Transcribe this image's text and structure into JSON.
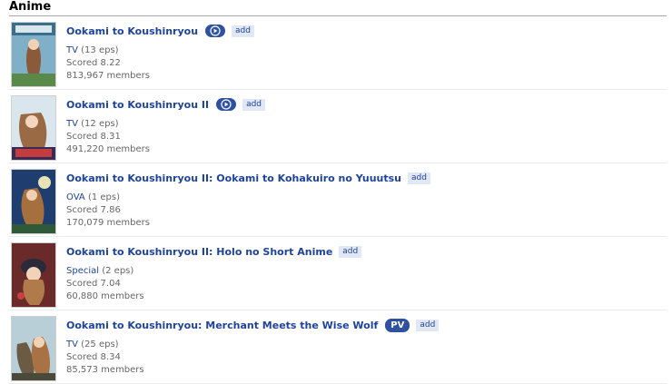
{
  "section": {
    "title": "Anime"
  },
  "entries": [
    {
      "title": "Ookami to Koushinryou",
      "type": "TV",
      "eps": "(13 eps)",
      "score": "Scored 8.22",
      "members": "813,967 members",
      "badge": "play",
      "add": "add"
    },
    {
      "title": "Ookami to Koushinryou II",
      "type": "TV",
      "eps": "(12 eps)",
      "score": "Scored 8.31",
      "members": "491,220 members",
      "badge": "play",
      "add": "add"
    },
    {
      "title": "Ookami to Koushinryou II: Ookami to Kohakuiro no Yuuutsu",
      "type": "OVA",
      "eps": "(1 eps)",
      "score": "Scored 7.86",
      "members": "170,079 members",
      "badge": "none",
      "add": "add"
    },
    {
      "title": "Ookami to Koushinryou II: Holo no Short Anime",
      "type": "Special",
      "eps": "(2 eps)",
      "score": "Scored 7.04",
      "members": "60,880 members",
      "badge": "none",
      "add": "add"
    },
    {
      "title": "Ookami to Koushinryou: Merchant Meets the Wise Wolf",
      "type": "TV",
      "eps": "(25 eps)",
      "score": "Scored 8.34",
      "members": "85,573 members",
      "badge": "pv",
      "pv_label": "PV",
      "add": "add"
    }
  ]
}
